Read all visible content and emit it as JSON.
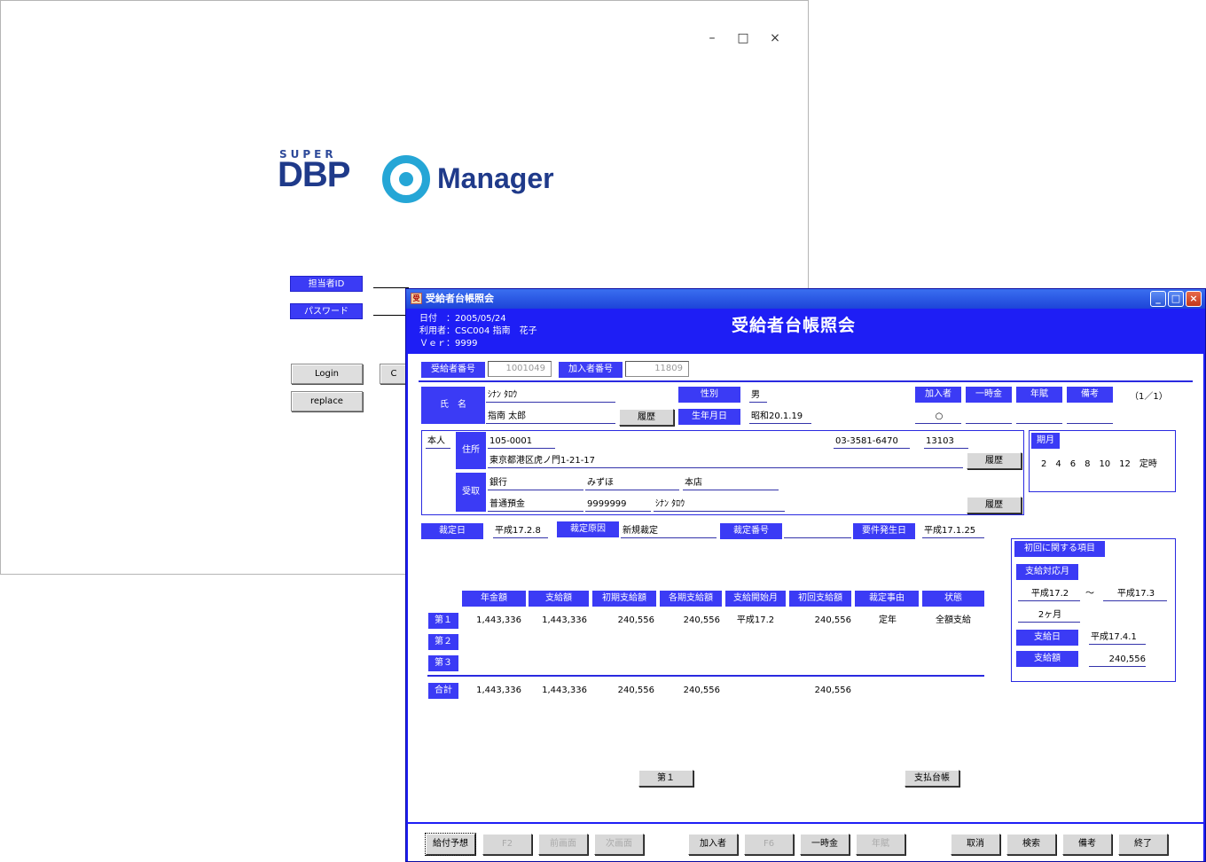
{
  "login": {
    "window_controls": {
      "minimize": "–",
      "maximize": "□",
      "close": "×"
    },
    "logo": {
      "super": "SUPER",
      "dbp": "DBP",
      "manager": "Manager"
    },
    "user_id_label": "担当者ID",
    "password_label": "パスワード",
    "login_button": "Login",
    "replace_button": "replace",
    "partial_button": "C"
  },
  "main": {
    "window_title": "受給者台帳照会",
    "app_icon": "受",
    "controls": {
      "minimize": "_",
      "maximize": "□",
      "close": "×"
    },
    "header": {
      "date_line": "日付　：2005/05/24",
      "user_line": "利用者：CSC004 指南　花子",
      "ver_line": "Ｖｅｒ：9999",
      "title": "受給者台帳照会"
    },
    "ids": {
      "recipient_no_label": "受給者番号",
      "recipient_no_value": "1001049",
      "member_no_label": "加入者番号",
      "member_no_value": "11809"
    },
    "person": {
      "name_label": "氏　名",
      "name_kana": "ｼﾅﾝ ﾀﾛｳ",
      "name": "指南 太郎",
      "history_button": "履歴",
      "gender_label": "性別",
      "gender": "男",
      "birth_label": "生年月日",
      "birth": "昭和20.1.19",
      "tabs": [
        "加入者",
        "一時金",
        "年賦",
        "備考"
      ],
      "member_mark": "○",
      "page_indicator": "（1／1）"
    },
    "address": {
      "self_label": "本人",
      "address_label": "住所",
      "postal": "105-0001",
      "phone": "03-3581-6470",
      "code": "13103",
      "address": "東京都港区虎ノ門1-21-17",
      "history_button": "履歴",
      "receive_label": "受取",
      "bank_type": "銀行",
      "bank_name": "みずほ",
      "branch": "本店",
      "account_type": "普通預金",
      "account_no": "9999999",
      "account_name": "ｼﾅﾝ ﾀﾛｳ",
      "history_button2": "履歴"
    },
    "period": {
      "label": "期月",
      "months": "2　4　6　8　10　12　定時"
    },
    "decision": {
      "date_label": "裁定日",
      "date": "平成17.2.8",
      "reason_label": "裁定原因",
      "reason": "新規裁定",
      "number_label": "裁定番号",
      "number": "",
      "occur_label": "要件発生日",
      "occur": "平成17.1.25"
    },
    "first_time": {
      "title": "初回に関する項目",
      "period_label": "支給対応月",
      "from": "平成17.2",
      "tilde": "～",
      "to": "平成17.3",
      "months": "2ヶ月",
      "pay_date_label": "支給日",
      "pay_date": "平成17.4.1",
      "amount_label": "支給額",
      "amount": "240,556"
    },
    "table": {
      "headers": [
        "年金額",
        "支給額",
        "初期支給額",
        "各期支給額",
        "支給開始月",
        "初回支給額",
        "裁定事由",
        "状態"
      ],
      "rows": [
        {
          "label": "第１",
          "cells": [
            "1,443,336",
            "1,443,336",
            "240,556",
            "240,556",
            "平成17.2",
            "240,556",
            "定年",
            "全額支給"
          ]
        },
        {
          "label": "第２",
          "cells": [
            "",
            "",
            "",
            "",
            "",
            "",
            "",
            ""
          ]
        },
        {
          "label": "第３",
          "cells": [
            "",
            "",
            "",
            "",
            "",
            "",
            "",
            ""
          ]
        }
      ],
      "total": {
        "label": "合計",
        "cells": [
          "1,443,336",
          "1,443,336",
          "240,556",
          "240,556",
          "",
          "240,556",
          "",
          ""
        ]
      }
    },
    "bottom_buttons": {
      "first": "第１",
      "ledger": "支払台帳"
    },
    "fkeys": [
      {
        "label": "給付予想",
        "enabled": true
      },
      {
        "label": "F2",
        "enabled": false
      },
      {
        "label": "前画面",
        "enabled": false
      },
      {
        "label": "次画面",
        "enabled": false
      },
      {
        "label": "加入者",
        "enabled": true
      },
      {
        "label": "F6",
        "enabled": false
      },
      {
        "label": "一時金",
        "enabled": true
      },
      {
        "label": "年賦",
        "enabled": false
      },
      {
        "label": "取消",
        "enabled": true
      },
      {
        "label": "検索",
        "enabled": true
      },
      {
        "label": "備考",
        "enabled": true
      },
      {
        "label": "終了",
        "enabled": true
      }
    ],
    "colors": {
      "primary_blue": "#1e1ef5",
      "label_blue": "#3b3bf5"
    }
  }
}
